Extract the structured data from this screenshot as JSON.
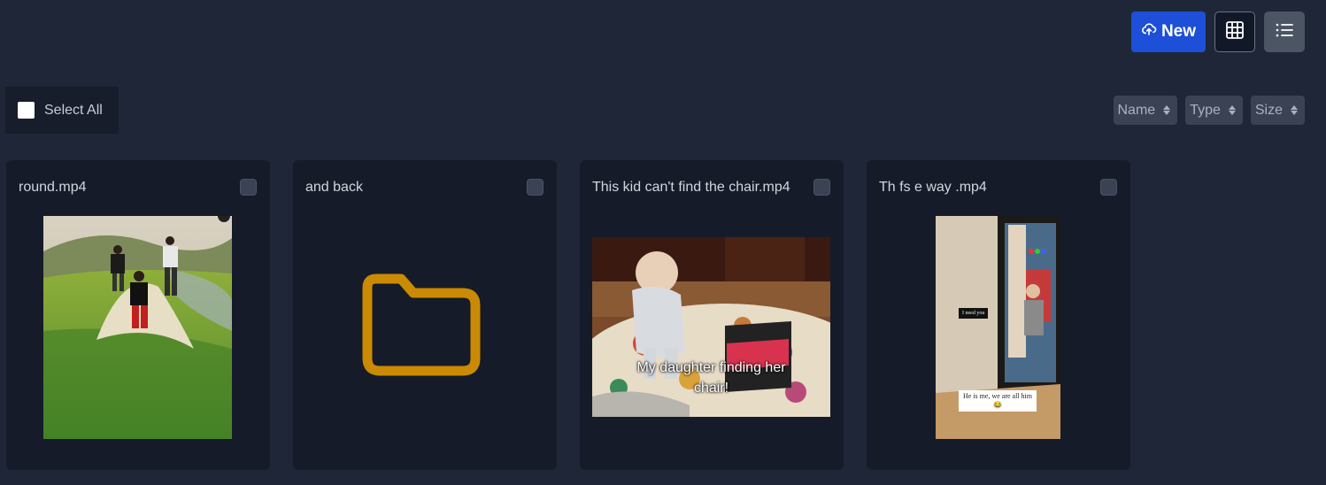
{
  "toolbar": {
    "new_label": "New",
    "icons": [
      "cloud-upload-icon",
      "grid-view-icon",
      "list-view-icon"
    ],
    "accent": "#1d4fd8"
  },
  "selection": {
    "select_all_label": "Select All"
  },
  "sort": {
    "name_label": "Name",
    "type_label": "Type",
    "size_label": "Size"
  },
  "items": [
    {
      "title": "round.mp4",
      "kind": "video"
    },
    {
      "title": "and back",
      "kind": "folder",
      "icon": "folder-icon",
      "icon_color": "#ca8a04"
    },
    {
      "title": "This kid can't find the chair.mp4",
      "kind": "video",
      "caption_line1": "My daughter finding her",
      "caption_line2": "chair!"
    },
    {
      "title": "Th fs e way .mp4",
      "kind": "video",
      "tag": "I need you",
      "note_line1": "He is me, we are all him",
      "note_emoji": "😂"
    }
  ]
}
